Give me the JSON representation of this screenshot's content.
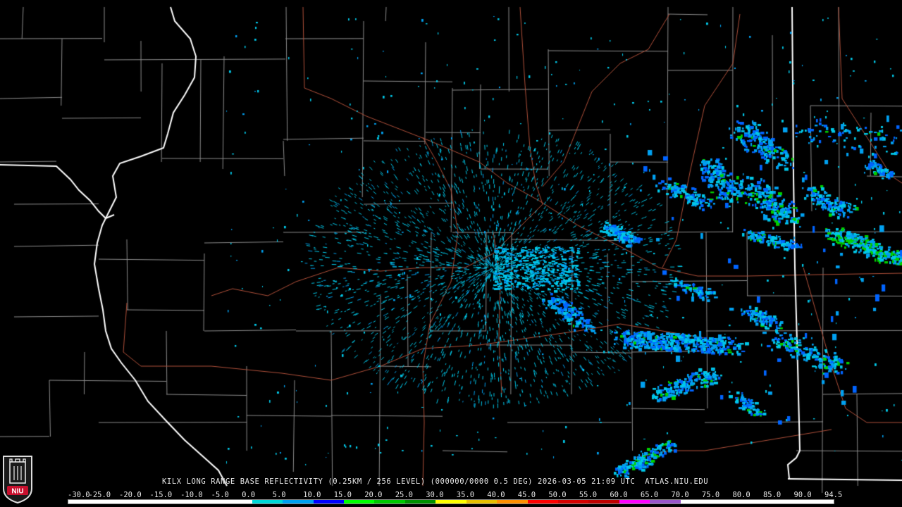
{
  "product_caption": "KILX LONG RANGE BASE REFLECTIVITY (0.25KM / 256 LEVEL) (000000/0000 0.5 DEG) 2026-03-05 21:09 UTC  ATLAS.NIU.EDU",
  "logo": {
    "text": "NIU",
    "accent_color": "#c8102e"
  },
  "legend": {
    "labels": [
      "-30.0",
      "-25.0",
      "-20.0",
      "-15.0",
      "-10.0",
      "-5.0",
      "0.0",
      "5.0",
      "10.0",
      "15.0",
      "20.0",
      "25.0",
      "30.0",
      "35.0",
      "40.0",
      "45.0",
      "50.0",
      "55.0",
      "60.0",
      "65.0",
      "70.0",
      "75.0",
      "80.0",
      "85.0",
      "90.0",
      "94.5"
    ],
    "colors": [
      "#ffffff",
      "#ffffff",
      "#ffffff",
      "#ffffff",
      "#ffffff",
      "#ffffff",
      "#00d8d8",
      "#00a0f0",
      "#0000ff",
      "#00ff00",
      "#00c800",
      "#009000",
      "#ffff00",
      "#e7c000",
      "#ff9000",
      "#ff0000",
      "#d60000",
      "#c00000",
      "#ff00ff",
      "#9955c9",
      "#ffffff",
      "#ffffff",
      "#ffffff",
      "#ffffff",
      "#ffffff"
    ]
  },
  "map": {
    "state_border_color": "#ffffff",
    "county_line_color": "#8c8c8c",
    "highway_color": "#b0503a",
    "echo_colors": [
      "#00c8e8",
      "#00a0f0",
      "#0064ff",
      "#00d000",
      "#00ff80"
    ]
  }
}
